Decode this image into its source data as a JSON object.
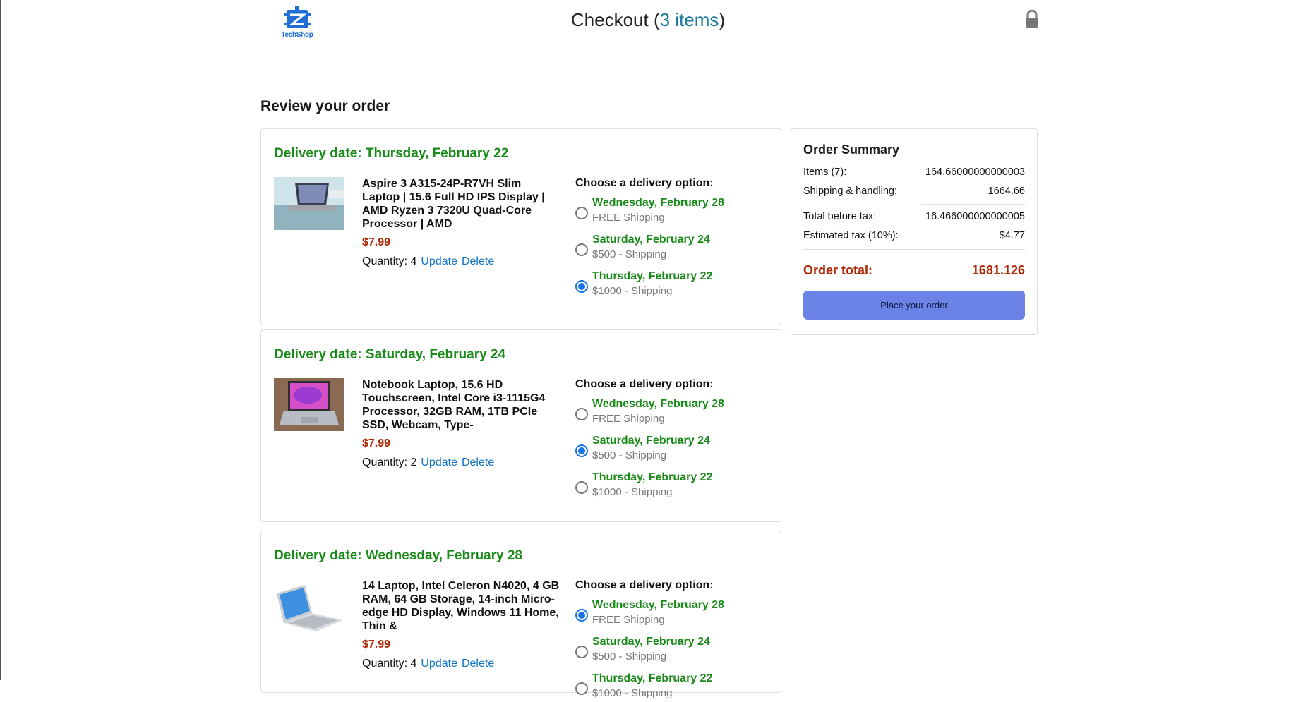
{
  "header": {
    "logo_text": "TechShop",
    "title_prefix": "Checkout (",
    "items_link": "3 items",
    "title_suffix": ")",
    "lock_icon": "lock-icon"
  },
  "review_title": "Review your order",
  "colors": {
    "delivery_green": "#188a18",
    "price_red": "#b12704",
    "link_blue": "#0f73c3",
    "button_blue": "#6b82e6"
  },
  "orders": [
    {
      "delivery_date": "Delivery date: Thursday, February 22",
      "product_name": "Aspire 3 A315-24P-R7VH Slim Laptop | 15.6 Full HD IPS Display | AMD Ryzen 3 7320U Quad-Core Processor | AMD",
      "price": "$7.99",
      "quantity_label": "Quantity: 4",
      "update_label": "Update",
      "delete_label": "Delete",
      "options_title": "Choose a delivery option:",
      "options": [
        {
          "date": "Wednesday, February 28",
          "price": "FREE Shipping",
          "selected": false
        },
        {
          "date": "Saturday, February 24",
          "price": "$500 - Shipping",
          "selected": false
        },
        {
          "date": "Thursday, February 22",
          "price": "$1000 - Shipping",
          "selected": true
        }
      ]
    },
    {
      "delivery_date": "Delivery date: Saturday, February 24",
      "product_name": "Notebook Laptop, 15.6 HD Touchscreen, Intel Core i3-1115G4 Processor, 32GB RAM, 1TB PCIe SSD, Webcam, Type-",
      "price": "$7.99",
      "quantity_label": "Quantity: 2",
      "update_label": "Update",
      "delete_label": "Delete",
      "options_title": "Choose a delivery option:",
      "options": [
        {
          "date": "Wednesday, February 28",
          "price": "FREE Shipping",
          "selected": false
        },
        {
          "date": "Saturday, February 24",
          "price": "$500 - Shipping",
          "selected": true
        },
        {
          "date": "Thursday, February 22",
          "price": "$1000 - Shipping",
          "selected": false
        }
      ]
    },
    {
      "delivery_date": "Delivery date: Wednesday, February 28",
      "product_name": "14 Laptop, Intel Celeron N4020, 4 GB RAM, 64 GB Storage, 14-inch Micro-edge HD Display, Windows 11 Home, Thin &",
      "price": "$7.99",
      "quantity_label": "Quantity: 4",
      "update_label": "Update",
      "delete_label": "Delete",
      "options_title": "Choose a delivery option:",
      "options": [
        {
          "date": "Wednesday, February 28",
          "price": "FREE Shipping",
          "selected": true
        },
        {
          "date": "Saturday, February 24",
          "price": "$500 - Shipping",
          "selected": false
        },
        {
          "date": "Thursday, February 22",
          "price": "$1000 - Shipping",
          "selected": false
        }
      ]
    }
  ],
  "summary": {
    "title": "Order Summary",
    "items_label": "Items (7):",
    "items_value": "164.66000000000003",
    "shipping_label": "Shipping & handling:",
    "shipping_value": "1664.66",
    "before_tax_label": "Total before tax:",
    "before_tax_value": "16.466000000000005",
    "tax_label": "Estimated tax (10%):",
    "tax_value": "$4.77",
    "total_label": "Order total:",
    "total_value": "1681.126",
    "place_order_label": "Place your order"
  }
}
